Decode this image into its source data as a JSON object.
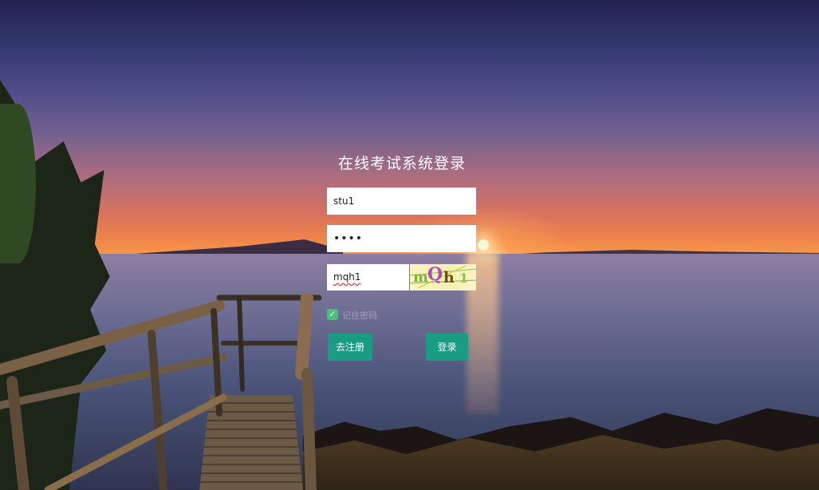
{
  "login": {
    "title": "在线考试系统登录",
    "username_value": "stu1",
    "password_value": "••••",
    "captcha_value": "mqh1",
    "captcha_image_text": [
      "m",
      "Q",
      "h",
      "1"
    ],
    "remember_label": "记住密码",
    "register_button": "去注册",
    "login_button": "登录"
  },
  "colors": {
    "button_bg": "#1a9c83",
    "checkbox_checked": "#4cc07a"
  }
}
